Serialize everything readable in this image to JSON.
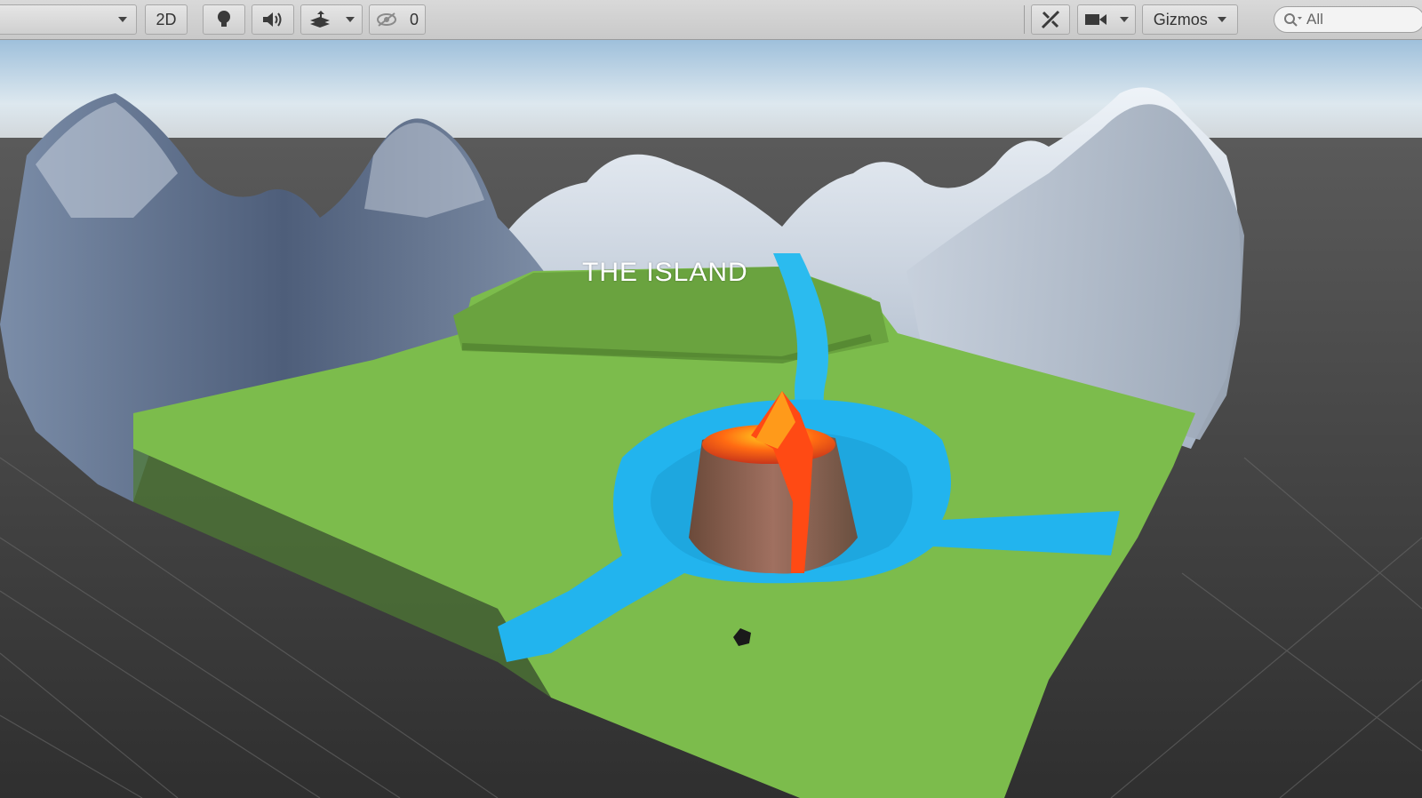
{
  "toolbar": {
    "shading_dropdown_label": "",
    "mode_2d_label": "2D",
    "hidden_count": "0",
    "gizmos_label": "Gizmos",
    "search_placeholder": "All"
  },
  "scene": {
    "title_text": "THE ISLAND"
  },
  "colors": {
    "toolbar_bg": "#d2d2d2",
    "grass": "#7dbb4b",
    "water": "#1fb6f0",
    "lava": "#ff5a1a",
    "mountains": "#a9b5c6",
    "sky": "#cfe0ef",
    "ground_plane": "#3b3b3b"
  }
}
